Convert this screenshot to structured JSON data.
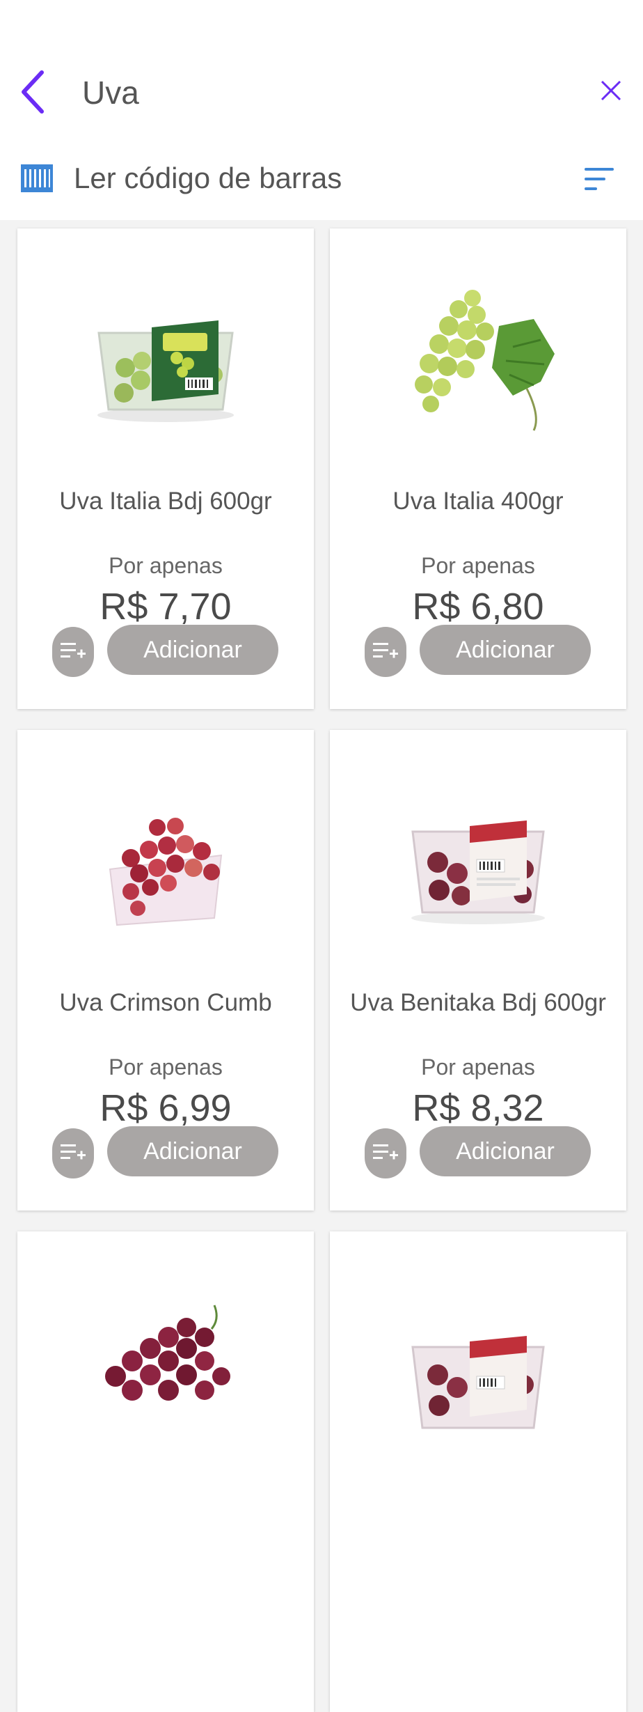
{
  "search": {
    "query": "Uva"
  },
  "barcode": {
    "label": "Ler código de barras"
  },
  "colors": {
    "accent": "#6b2cf5",
    "barcode_blue": "#3d86d6",
    "button_gray": "#a9a6a5"
  },
  "products": [
    {
      "name": "Uva Italia Bdj 600gr",
      "price_prefix": "Por apenas",
      "price": "R$ 7,70",
      "add_label": "Adicionar",
      "image": "green-grapes-package"
    },
    {
      "name": "Uva Italia 400gr",
      "price_prefix": "Por apenas",
      "price": "R$ 6,80",
      "add_label": "Adicionar",
      "image": "green-grapes-bunch"
    },
    {
      "name": "Uva Crimson Cumb",
      "price_prefix": "Por apenas",
      "price": "R$ 6,99",
      "add_label": "Adicionar",
      "image": "red-grapes-basket"
    },
    {
      "name": "Uva Benitaka Bdj 600gr",
      "price_prefix": "Por apenas",
      "price": "R$ 8,32",
      "add_label": "Adicionar",
      "image": "red-grapes-package"
    },
    {
      "name": "",
      "price_prefix": "",
      "price": "",
      "add_label": "",
      "image": "red-grapes-bunch"
    },
    {
      "name": "",
      "price_prefix": "",
      "price": "",
      "add_label": "",
      "image": "red-grapes-package"
    }
  ]
}
